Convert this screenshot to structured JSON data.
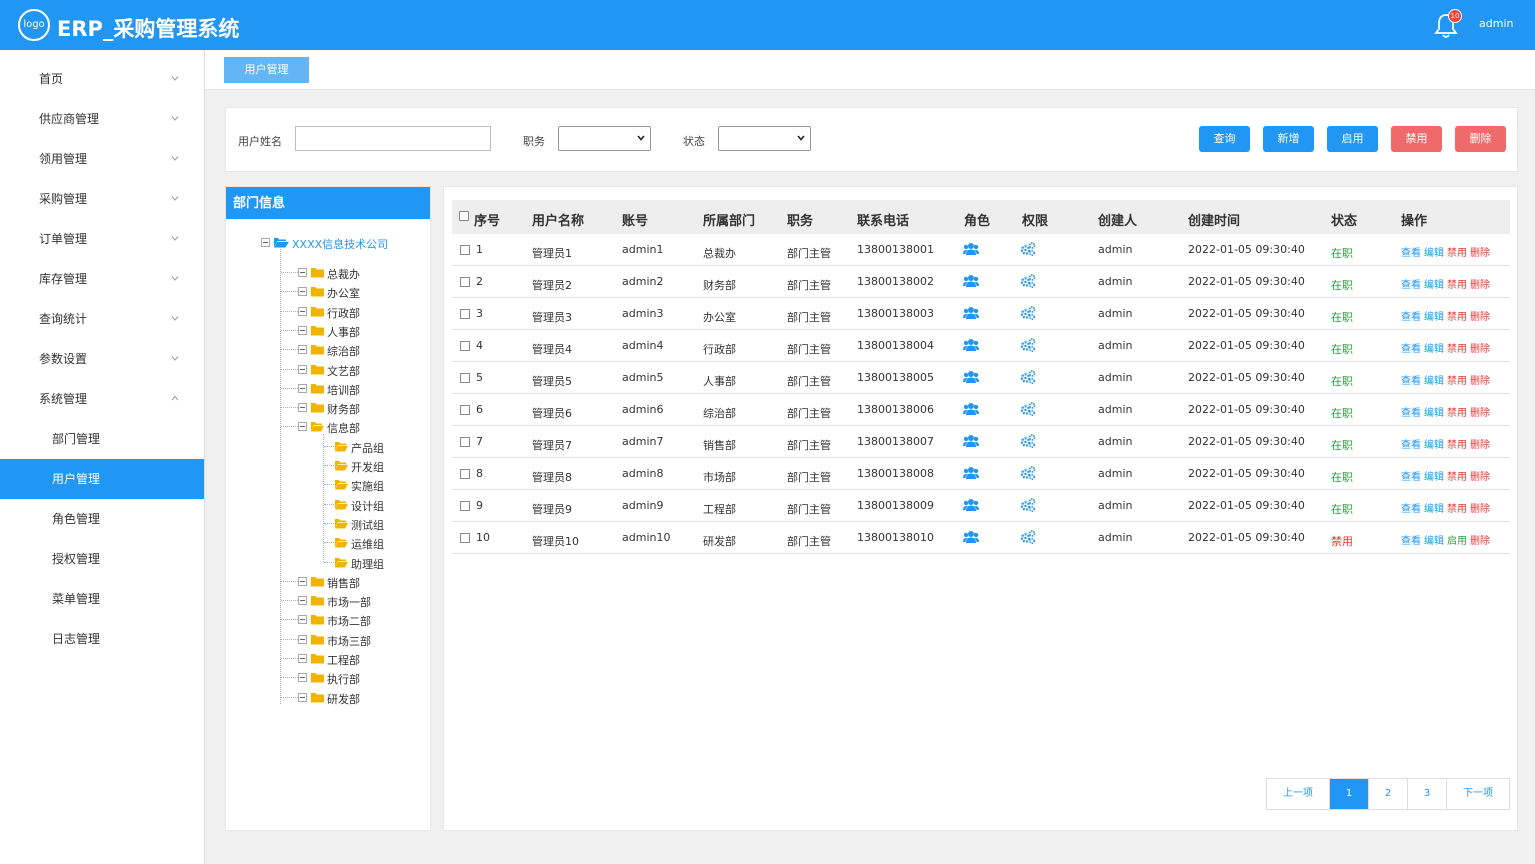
{
  "header": {
    "logo_text": "logo",
    "title": "ERP_采购管理系统",
    "notification_count": "10",
    "user": "admin"
  },
  "sidebar": {
    "items": [
      {
        "label": "首页",
        "expanded": false
      },
      {
        "label": "供应商管理",
        "expanded": false
      },
      {
        "label": "领用管理",
        "expanded": false
      },
      {
        "label": "采购管理",
        "expanded": false
      },
      {
        "label": "订单管理",
        "expanded": false
      },
      {
        "label": "库存管理",
        "expanded": false
      },
      {
        "label": "查询统计",
        "expanded": false
      },
      {
        "label": "参数设置",
        "expanded": false
      },
      {
        "label": "系统管理",
        "expanded": true
      }
    ],
    "sub_items": [
      {
        "label": "部门管理",
        "active": false
      },
      {
        "label": "用户管理",
        "active": true
      },
      {
        "label": "角色管理",
        "active": false
      },
      {
        "label": "授权管理",
        "active": false
      },
      {
        "label": "菜单管理",
        "active": false
      },
      {
        "label": "日志管理",
        "active": false
      }
    ]
  },
  "breadcrumb": {
    "tab": "用户管理"
  },
  "search": {
    "username_label": "用户姓名",
    "username_value": "",
    "position_label": "职务",
    "position_value": "",
    "status_label": "状态",
    "status_value": "",
    "buttons": {
      "query": "查询",
      "add": "新增",
      "enable": "启用",
      "disable": "禁用",
      "delete": "删除"
    }
  },
  "dept": {
    "title": "部门信息",
    "root": "XXXX信息技术公司",
    "children_before": [
      "总裁办",
      "办公室",
      "行政部",
      "人事部",
      "综治部",
      "文艺部",
      "培训部",
      "财务部"
    ],
    "expanded": "信息部",
    "sub_groups": [
      "产品组",
      "开发组",
      "实施组",
      "设计组",
      "测试组",
      "运维组",
      "助理组"
    ],
    "children_after": [
      "销售部",
      "市场一部",
      "市场二部",
      "市场三部",
      "工程部",
      "执行部",
      "研发部"
    ]
  },
  "table": {
    "columns": [
      "序号",
      "用户名称",
      "账号",
      "所属部门",
      "职务",
      "联系电话",
      "角色",
      "权限",
      "创建人",
      "创建时间",
      "状态",
      "操作"
    ],
    "rows": [
      {
        "no": "1",
        "name": "管理员1",
        "account": "admin1",
        "dept": "总裁办",
        "position": "部门主管",
        "phone": "13800138001",
        "creator": "admin",
        "created": "2022-01-05 09:30:40",
        "status": "在职",
        "ops": [
          "查看",
          "编辑",
          "禁用",
          "删除"
        ]
      },
      {
        "no": "2",
        "name": "管理员2",
        "account": "admin2",
        "dept": "财务部",
        "position": "部门主管",
        "phone": "13800138002",
        "creator": "admin",
        "created": "2022-01-05 09:30:40",
        "status": "在职",
        "ops": [
          "查看",
          "编辑",
          "禁用",
          "删除"
        ]
      },
      {
        "no": "3",
        "name": "管理员3",
        "account": "admin3",
        "dept": "办公室",
        "position": "部门主管",
        "phone": "13800138003",
        "creator": "admin",
        "created": "2022-01-05 09:30:40",
        "status": "在职",
        "ops": [
          "查看",
          "编辑",
          "禁用",
          "删除"
        ]
      },
      {
        "no": "4",
        "name": "管理员4",
        "account": "admin4",
        "dept": "行政部",
        "position": "部门主管",
        "phone": "13800138004",
        "creator": "admin",
        "created": "2022-01-05 09:30:40",
        "status": "在职",
        "ops": [
          "查看",
          "编辑",
          "禁用",
          "删除"
        ]
      },
      {
        "no": "5",
        "name": "管理员5",
        "account": "admin5",
        "dept": "人事部",
        "position": "部门主管",
        "phone": "13800138005",
        "creator": "admin",
        "created": "2022-01-05 09:30:40",
        "status": "在职",
        "ops": [
          "查看",
          "编辑",
          "禁用",
          "删除"
        ]
      },
      {
        "no": "6",
        "name": "管理员6",
        "account": "admin6",
        "dept": "综治部",
        "position": "部门主管",
        "phone": "13800138006",
        "creator": "admin",
        "created": "2022-01-05 09:30:40",
        "status": "在职",
        "ops": [
          "查看",
          "编辑",
          "禁用",
          "删除"
        ]
      },
      {
        "no": "7",
        "name": "管理员7",
        "account": "admin7",
        "dept": "销售部",
        "position": "部门主管",
        "phone": "13800138007",
        "creator": "admin",
        "created": "2022-01-05 09:30:40",
        "status": "在职",
        "ops": [
          "查看",
          "编辑",
          "禁用",
          "删除"
        ]
      },
      {
        "no": "8",
        "name": "管理员8",
        "account": "admin8",
        "dept": "市场部",
        "position": "部门主管",
        "phone": "13800138008",
        "creator": "admin",
        "created": "2022-01-05 09:30:40",
        "status": "在职",
        "ops": [
          "查看",
          "编辑",
          "禁用",
          "删除"
        ]
      },
      {
        "no": "9",
        "name": "管理员9",
        "account": "admin9",
        "dept": "工程部",
        "position": "部门主管",
        "phone": "13800138009",
        "creator": "admin",
        "created": "2022-01-05 09:30:40",
        "status": "在职",
        "ops": [
          "查看",
          "编辑",
          "禁用",
          "删除"
        ]
      },
      {
        "no": "10",
        "name": "管理员10",
        "account": "admin10",
        "dept": "研发部",
        "position": "部门主管",
        "phone": "13800138010",
        "creator": "admin",
        "created": "2022-01-05 09:30:40",
        "status": "禁用",
        "ops": [
          "查看",
          "编辑",
          "启用",
          "删除"
        ]
      }
    ]
  },
  "pagination": {
    "prev": "上一项",
    "pages": [
      "1",
      "2",
      "3"
    ],
    "current": "1",
    "next": "下一项"
  },
  "colors": {
    "primary": "#2196f3",
    "danger": "#ef6a6a",
    "success": "#2e9e3e",
    "folder": "#f0b400"
  },
  "icons": {
    "role": "users-icon",
    "permission": "gears-icon",
    "nav_chevron": "chevron-down-icon",
    "notification": "bell-icon"
  }
}
